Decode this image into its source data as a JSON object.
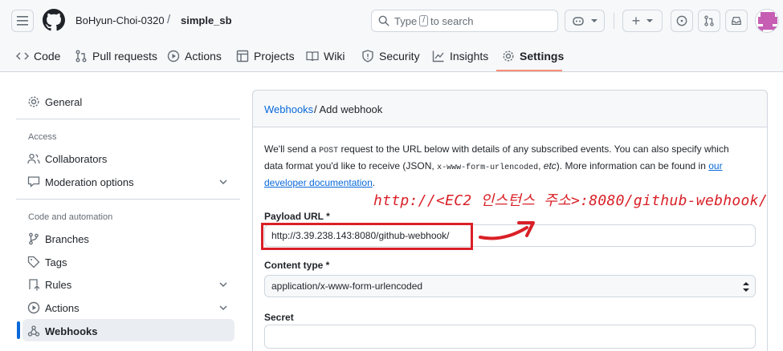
{
  "header": {
    "owner": "BoHyun-Choi-0320",
    "separator": "/",
    "repo": "simple_sb",
    "search_prefix": "Type",
    "search_key": "/",
    "search_suffix": "to search",
    "plus_label": "+"
  },
  "tabs": [
    {
      "label": "Code",
      "icon": "code-icon"
    },
    {
      "label": "Pull requests",
      "icon": "pull-request-icon"
    },
    {
      "label": "Actions",
      "icon": "play-icon"
    },
    {
      "label": "Projects",
      "icon": "table-icon"
    },
    {
      "label": "Wiki",
      "icon": "book-icon"
    },
    {
      "label": "Security",
      "icon": "shield-icon"
    },
    {
      "label": "Insights",
      "icon": "graph-icon"
    },
    {
      "label": "Settings",
      "icon": "gear-icon"
    }
  ],
  "sidebar": {
    "general": "General",
    "access_heading": "Access",
    "collaborators": "Collaborators",
    "moderation": "Moderation options",
    "code_heading": "Code and automation",
    "branches": "Branches",
    "tags": "Tags",
    "rules": "Rules",
    "actions": "Actions",
    "webhooks": "Webhooks"
  },
  "main": {
    "breadcrumb_link": "Webhooks",
    "breadcrumb_rest": "/ Add webhook",
    "desc_1": "We'll send a",
    "desc_post": "POST",
    "desc_2": "request to the URL below with details of any subscribed events. You can also specify which data format you'd like to receive (JSON,",
    "desc_code": "x-www-form-urlencoded",
    "desc_etc": "etc",
    "desc_3": "). More information can be found in",
    "desc_link": "our developer documentation",
    "desc_end": ".",
    "payload_label": "Payload URL *",
    "payload_value": "http://3.39.238.143:8080/github-webhook/",
    "content_type_label": "Content type *",
    "content_type_value": "application/x-www-form-urlencoded",
    "secret_label": "Secret",
    "secret_value": ""
  },
  "annotation": {
    "text": "http://<EC2 인스턴스 주소>:8080/github-webhook/",
    "color": "#d92027"
  }
}
